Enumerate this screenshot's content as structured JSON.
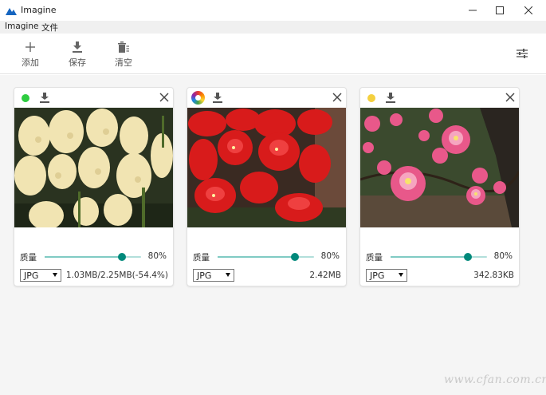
{
  "window": {
    "title": "Imagine"
  },
  "menu": {
    "items": [
      "Imagine",
      "文件"
    ]
  },
  "toolbar": {
    "add_label": "添加",
    "save_label": "保存",
    "clear_label": "清空"
  },
  "cards": [
    {
      "status": "done",
      "status_color": "#2ecc40",
      "image": "hyacinth-flowers",
      "quality_label": "质量",
      "quality": 80,
      "quality_text": "80%",
      "format": "JPG",
      "size_text": "1.03MB/2.25MB(-54.4%)"
    },
    {
      "status": "processing",
      "status_color": "multicolor",
      "image": "red-amaryllis-flowers",
      "quality_label": "质量",
      "quality": 80,
      "quality_text": "80%",
      "format": "JPG",
      "size_text": "2.42MB"
    },
    {
      "status": "pending",
      "status_color": "#f4d03f",
      "image": "pink-quince-blossoms",
      "quality_label": "质量",
      "quality": 80,
      "quality_text": "80%",
      "format": "JPG",
      "size_text": "342.83KB"
    }
  ],
  "colors": {
    "accent": "#00897b",
    "track": "#b2dfdb",
    "workspace_bg": "#f5f5f5"
  },
  "watermark": "www.cfan.com.cn"
}
